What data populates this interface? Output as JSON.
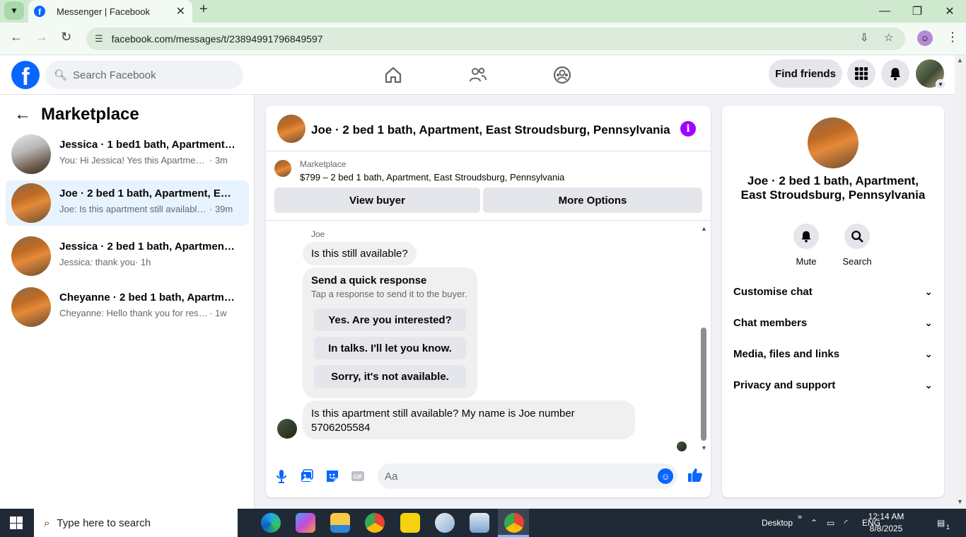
{
  "browser": {
    "tab_title": "Messenger | Facebook",
    "url": "facebook.com/messages/t/23894991796849597"
  },
  "header": {
    "search_placeholder": "Search Facebook",
    "find_friends_label": "Find friends"
  },
  "sidebar": {
    "title": "Marketplace",
    "conversations": [
      {
        "name": "Jessica · 1 bed1 bath, Apartment, E...",
        "snippet": "You: Hi Jessica! Yes this Apartment is ...",
        "time": " · 3m",
        "active": false
      },
      {
        "name": "Joe · 2 bed 1 bath, Apartment, East...",
        "snippet": "Joe: Is this apartment still available? ...",
        "time": " · 39m",
        "active": true
      },
      {
        "name": "Jessica · 2 bed 1 bath, Apartment, ...",
        "snippet": "Jessica: thank you",
        "time": " · 1h",
        "active": false
      },
      {
        "name": "Cheyanne · 2 bed 1 bath, Apartme...",
        "snippet": "Cheyanne: Hello thank you for respon...",
        "time": " · 1w",
        "active": false
      }
    ]
  },
  "chat": {
    "title": "Joe · 2 bed 1 bath, Apartment, East Stroudsburg, Pennsylvania",
    "marketplace_label": "Marketplace",
    "listing": "$799 – 2 bed 1 bath, Apartment, East Stroudsburg, Pennsylvania",
    "view_buyer_label": "View buyer",
    "more_options_label": "More Options",
    "sender_name": "Joe",
    "message_1": "Is this still available?",
    "quick_response_title": "Send a quick response",
    "quick_response_sub": "Tap a response to send it to the buyer.",
    "quick_responses": [
      "Yes. Are you interested?",
      "In talks. I'll let you know.",
      "Sorry, it's not available."
    ],
    "message_2_line1": "Is this apartment still available? My name is Joe number",
    "message_2_line2": "5706205584",
    "composer_placeholder": "Aa",
    "gif_label": "GIF"
  },
  "right_panel": {
    "title": "Joe · 2 bed 1 bath, Apartment, East Stroudsburg, Pennsylvania",
    "mute_label": "Mute",
    "search_label": "Search",
    "sections": [
      "Customise chat",
      "Chat members",
      "Media, files and links",
      "Privacy and support"
    ]
  },
  "taskbar": {
    "search_placeholder": "Type here to search",
    "desktop_label": "Desktop",
    "language": "ENG",
    "time": "12:14 AM",
    "date": "8/8/2025",
    "notification_count": "1"
  },
  "colors": {
    "fb_blue": "#0866ff",
    "messenger_purple": "#a100ff",
    "active_conversation": "#e7f3ff"
  }
}
